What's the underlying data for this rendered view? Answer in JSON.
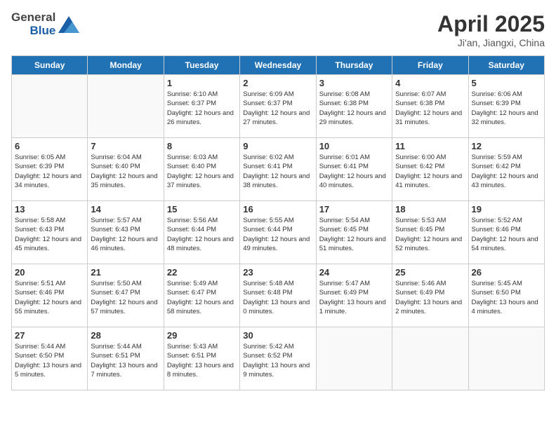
{
  "header": {
    "logo_general": "General",
    "logo_blue": "Blue",
    "title": "April 2025",
    "subtitle": "Ji'an, Jiangxi, China"
  },
  "weekdays": [
    "Sunday",
    "Monday",
    "Tuesday",
    "Wednesday",
    "Thursday",
    "Friday",
    "Saturday"
  ],
  "weeks": [
    [
      {
        "day": "",
        "sunrise": "",
        "sunset": "",
        "daylight": ""
      },
      {
        "day": "",
        "sunrise": "",
        "sunset": "",
        "daylight": ""
      },
      {
        "day": "1",
        "sunrise": "Sunrise: 6:10 AM",
        "sunset": "Sunset: 6:37 PM",
        "daylight": "Daylight: 12 hours and 26 minutes."
      },
      {
        "day": "2",
        "sunrise": "Sunrise: 6:09 AM",
        "sunset": "Sunset: 6:37 PM",
        "daylight": "Daylight: 12 hours and 27 minutes."
      },
      {
        "day": "3",
        "sunrise": "Sunrise: 6:08 AM",
        "sunset": "Sunset: 6:38 PM",
        "daylight": "Daylight: 12 hours and 29 minutes."
      },
      {
        "day": "4",
        "sunrise": "Sunrise: 6:07 AM",
        "sunset": "Sunset: 6:38 PM",
        "daylight": "Daylight: 12 hours and 31 minutes."
      },
      {
        "day": "5",
        "sunrise": "Sunrise: 6:06 AM",
        "sunset": "Sunset: 6:39 PM",
        "daylight": "Daylight: 12 hours and 32 minutes."
      }
    ],
    [
      {
        "day": "6",
        "sunrise": "Sunrise: 6:05 AM",
        "sunset": "Sunset: 6:39 PM",
        "daylight": "Daylight: 12 hours and 34 minutes."
      },
      {
        "day": "7",
        "sunrise": "Sunrise: 6:04 AM",
        "sunset": "Sunset: 6:40 PM",
        "daylight": "Daylight: 12 hours and 35 minutes."
      },
      {
        "day": "8",
        "sunrise": "Sunrise: 6:03 AM",
        "sunset": "Sunset: 6:40 PM",
        "daylight": "Daylight: 12 hours and 37 minutes."
      },
      {
        "day": "9",
        "sunrise": "Sunrise: 6:02 AM",
        "sunset": "Sunset: 6:41 PM",
        "daylight": "Daylight: 12 hours and 38 minutes."
      },
      {
        "day": "10",
        "sunrise": "Sunrise: 6:01 AM",
        "sunset": "Sunset: 6:41 PM",
        "daylight": "Daylight: 12 hours and 40 minutes."
      },
      {
        "day": "11",
        "sunrise": "Sunrise: 6:00 AM",
        "sunset": "Sunset: 6:42 PM",
        "daylight": "Daylight: 12 hours and 41 minutes."
      },
      {
        "day": "12",
        "sunrise": "Sunrise: 5:59 AM",
        "sunset": "Sunset: 6:42 PM",
        "daylight": "Daylight: 12 hours and 43 minutes."
      }
    ],
    [
      {
        "day": "13",
        "sunrise": "Sunrise: 5:58 AM",
        "sunset": "Sunset: 6:43 PM",
        "daylight": "Daylight: 12 hours and 45 minutes."
      },
      {
        "day": "14",
        "sunrise": "Sunrise: 5:57 AM",
        "sunset": "Sunset: 6:43 PM",
        "daylight": "Daylight: 12 hours and 46 minutes."
      },
      {
        "day": "15",
        "sunrise": "Sunrise: 5:56 AM",
        "sunset": "Sunset: 6:44 PM",
        "daylight": "Daylight: 12 hours and 48 minutes."
      },
      {
        "day": "16",
        "sunrise": "Sunrise: 5:55 AM",
        "sunset": "Sunset: 6:44 PM",
        "daylight": "Daylight: 12 hours and 49 minutes."
      },
      {
        "day": "17",
        "sunrise": "Sunrise: 5:54 AM",
        "sunset": "Sunset: 6:45 PM",
        "daylight": "Daylight: 12 hours and 51 minutes."
      },
      {
        "day": "18",
        "sunrise": "Sunrise: 5:53 AM",
        "sunset": "Sunset: 6:45 PM",
        "daylight": "Daylight: 12 hours and 52 minutes."
      },
      {
        "day": "19",
        "sunrise": "Sunrise: 5:52 AM",
        "sunset": "Sunset: 6:46 PM",
        "daylight": "Daylight: 12 hours and 54 minutes."
      }
    ],
    [
      {
        "day": "20",
        "sunrise": "Sunrise: 5:51 AM",
        "sunset": "Sunset: 6:46 PM",
        "daylight": "Daylight: 12 hours and 55 minutes."
      },
      {
        "day": "21",
        "sunrise": "Sunrise: 5:50 AM",
        "sunset": "Sunset: 6:47 PM",
        "daylight": "Daylight: 12 hours and 57 minutes."
      },
      {
        "day": "22",
        "sunrise": "Sunrise: 5:49 AM",
        "sunset": "Sunset: 6:47 PM",
        "daylight": "Daylight: 12 hours and 58 minutes."
      },
      {
        "day": "23",
        "sunrise": "Sunrise: 5:48 AM",
        "sunset": "Sunset: 6:48 PM",
        "daylight": "Daylight: 13 hours and 0 minutes."
      },
      {
        "day": "24",
        "sunrise": "Sunrise: 5:47 AM",
        "sunset": "Sunset: 6:49 PM",
        "daylight": "Daylight: 13 hours and 1 minute."
      },
      {
        "day": "25",
        "sunrise": "Sunrise: 5:46 AM",
        "sunset": "Sunset: 6:49 PM",
        "daylight": "Daylight: 13 hours and 2 minutes."
      },
      {
        "day": "26",
        "sunrise": "Sunrise: 5:45 AM",
        "sunset": "Sunset: 6:50 PM",
        "daylight": "Daylight: 13 hours and 4 minutes."
      }
    ],
    [
      {
        "day": "27",
        "sunrise": "Sunrise: 5:44 AM",
        "sunset": "Sunset: 6:50 PM",
        "daylight": "Daylight: 13 hours and 5 minutes."
      },
      {
        "day": "28",
        "sunrise": "Sunrise: 5:44 AM",
        "sunset": "Sunset: 6:51 PM",
        "daylight": "Daylight: 13 hours and 7 minutes."
      },
      {
        "day": "29",
        "sunrise": "Sunrise: 5:43 AM",
        "sunset": "Sunset: 6:51 PM",
        "daylight": "Daylight: 13 hours and 8 minutes."
      },
      {
        "day": "30",
        "sunrise": "Sunrise: 5:42 AM",
        "sunset": "Sunset: 6:52 PM",
        "daylight": "Daylight: 13 hours and 9 minutes."
      },
      {
        "day": "",
        "sunrise": "",
        "sunset": "",
        "daylight": ""
      },
      {
        "day": "",
        "sunrise": "",
        "sunset": "",
        "daylight": ""
      },
      {
        "day": "",
        "sunrise": "",
        "sunset": "",
        "daylight": ""
      }
    ]
  ]
}
